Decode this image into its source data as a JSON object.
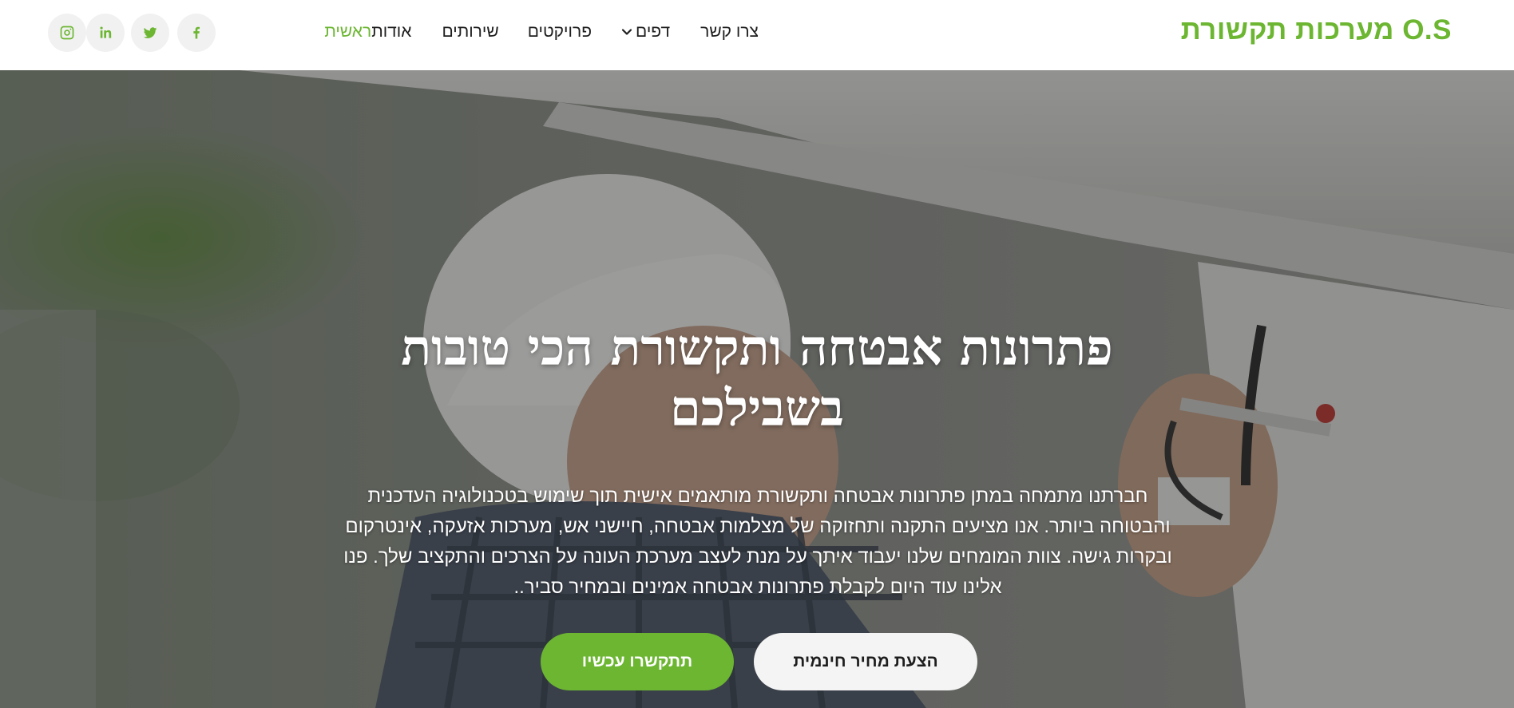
{
  "header": {
    "brand": "O.S מערכות תקשורת",
    "nav": [
      {
        "label": "ראשית",
        "active": true
      },
      {
        "label": "אודות",
        "active": false
      },
      {
        "label": "שירותים",
        "active": false
      },
      {
        "label": "פרויקטים",
        "active": false
      },
      {
        "label": "דפים",
        "active": false,
        "dropdown": true
      },
      {
        "label": "צרו קשר",
        "active": false
      }
    ],
    "socials": [
      "facebook-icon",
      "twitter-icon",
      "linkedin-icon",
      "instagram-icon"
    ]
  },
  "hero": {
    "title_line1": "פתרונות אבטחה ותקשורת הכי טובות",
    "title_line2": "בשבילכם",
    "text": "חברתנו מתמחה במתן פתרונות אבטחה ותקשורת מותאמים אישית תוך שימוש בטכנולוגיה העדכנית והבטוחה ביותר. אנו מציעים התקנה ותחזוקה של מצלמות אבטחה, חיישני אש, מערכות אזעקה, אינטרקום ובקרות גישה. צוות המומחים שלנו יעבוד איתך על מנת לעצב מערכת העונה על הצרכים והתקציב שלך. פנו אלינו עוד היום לקבלת פתרונות אבטחה אמינים ובמחיר סביר..",
    "buttons": {
      "quote": "הצעת מחיר חינמית",
      "contact": "תתקשרו עכשיו"
    }
  },
  "colors": {
    "accent": "#6cb632",
    "overlay": "#282828",
    "nav_text": "#1e1e1e"
  }
}
